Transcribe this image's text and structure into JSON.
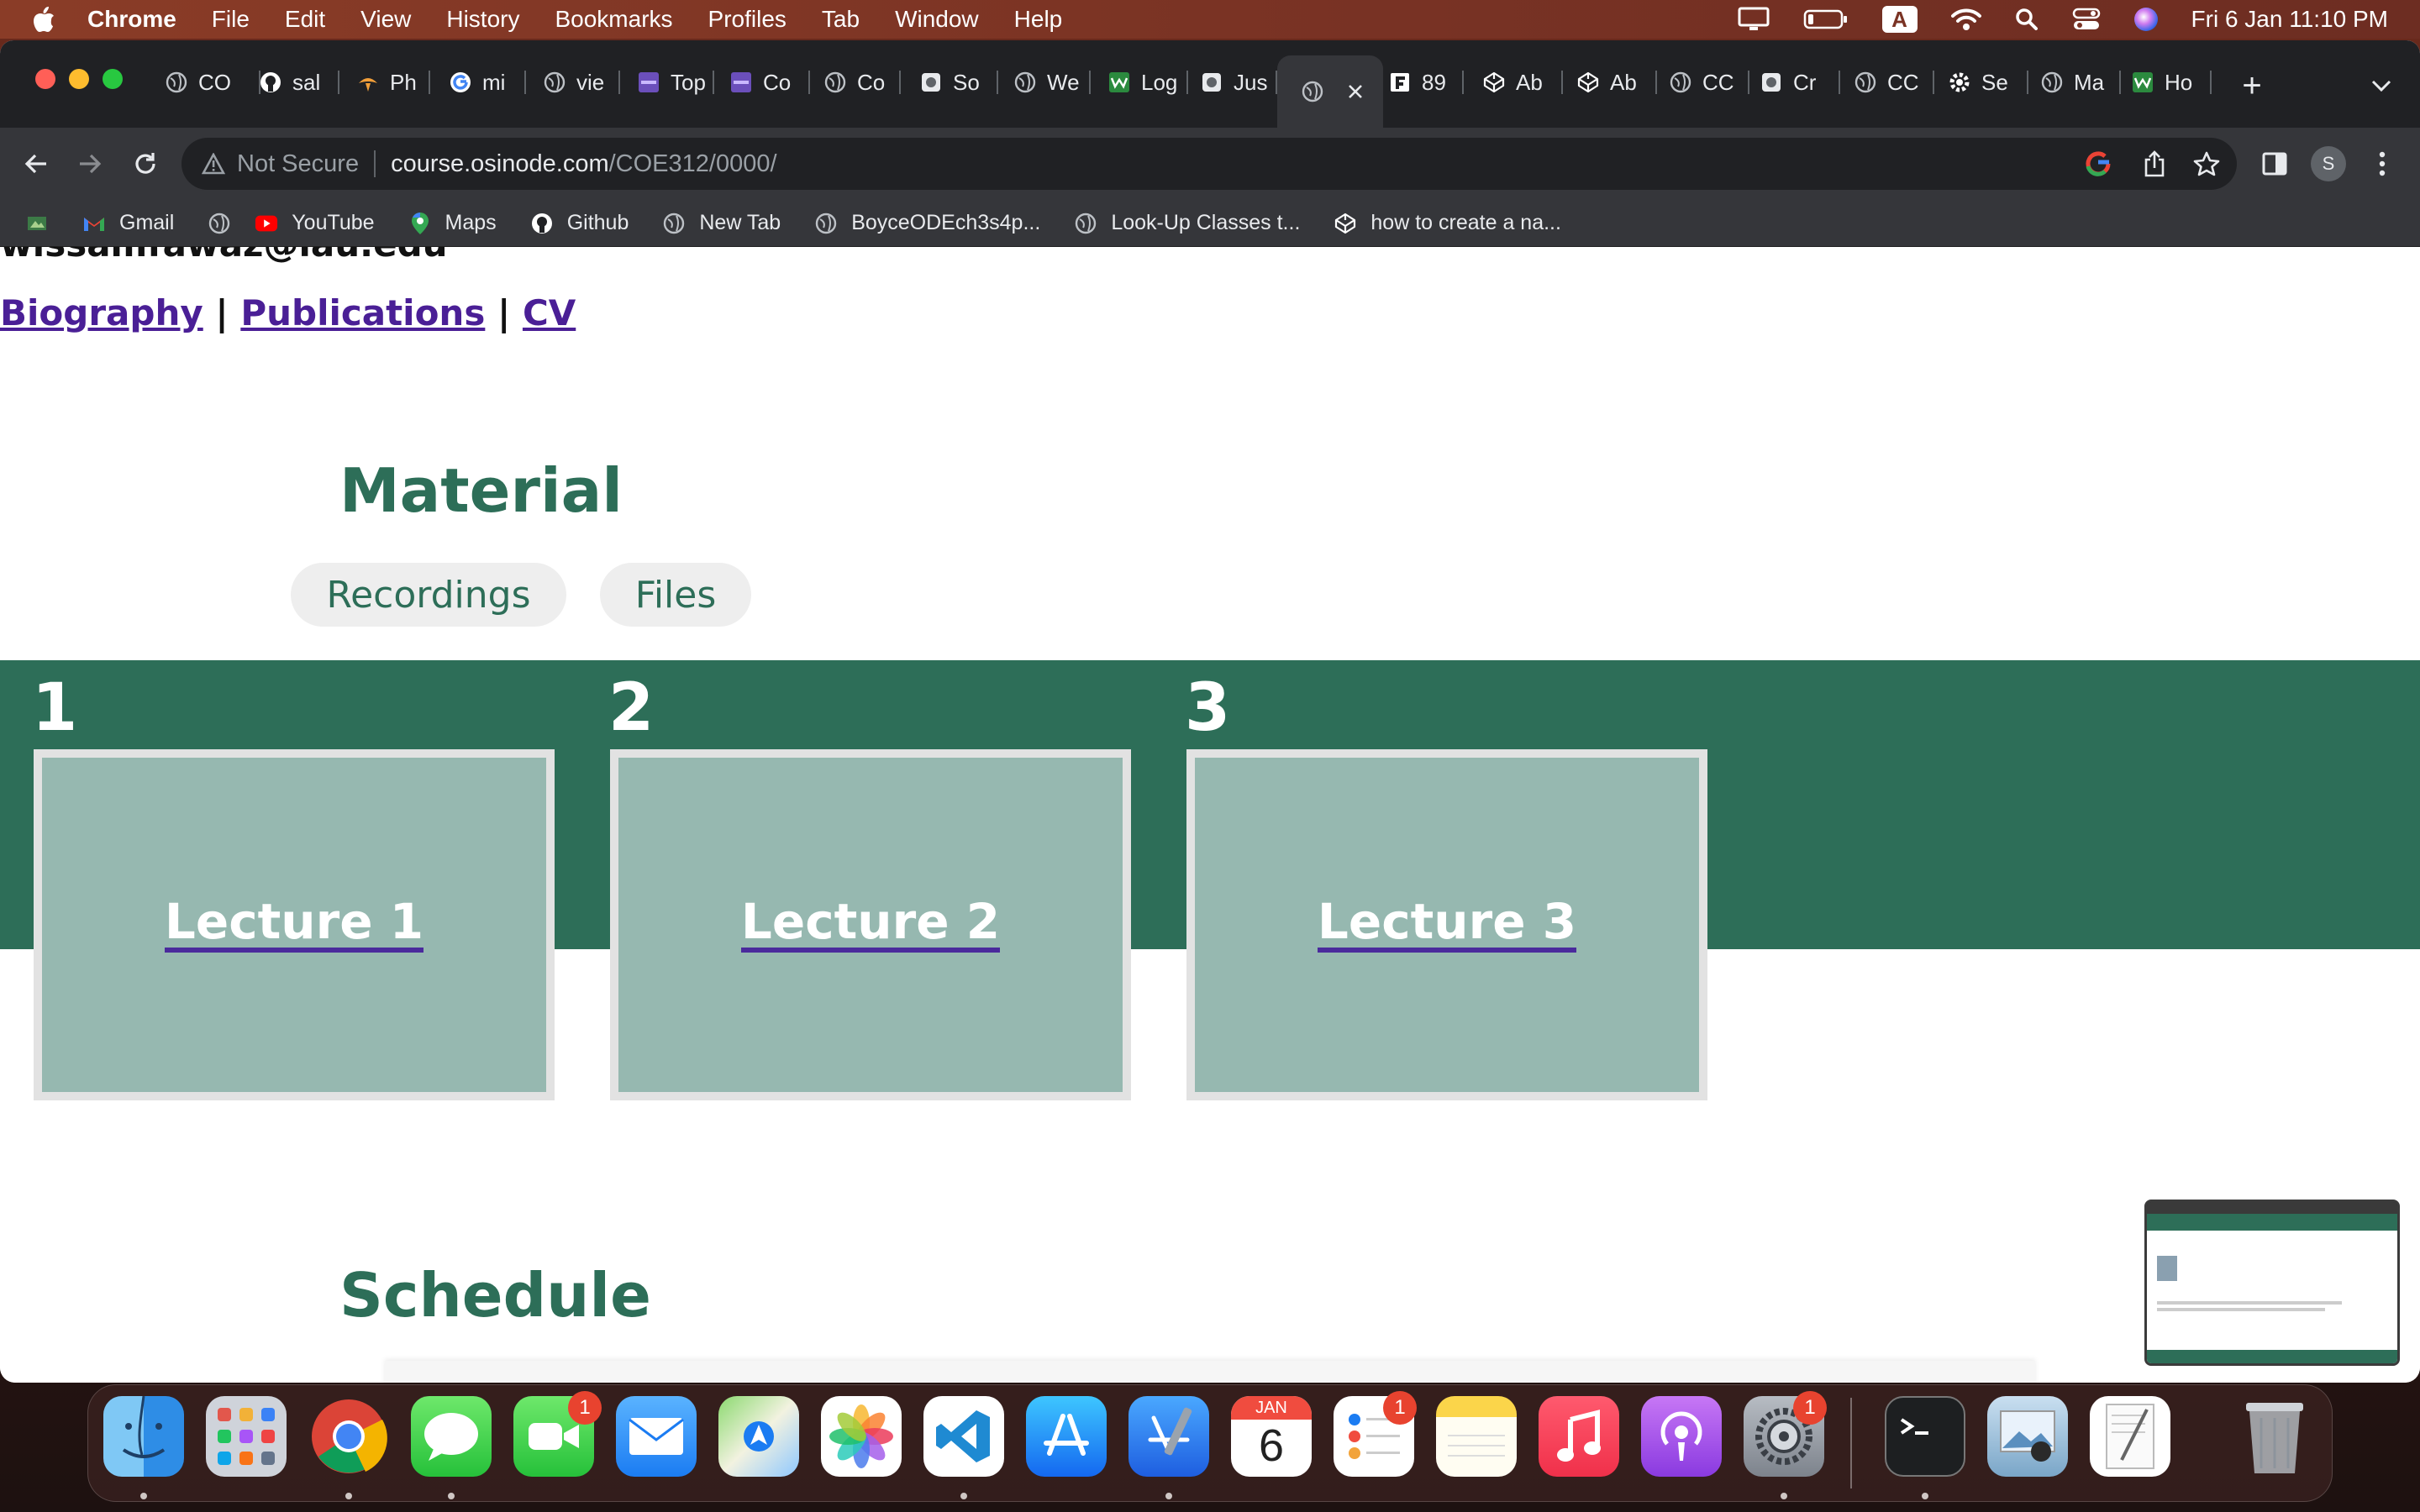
{
  "menubar": {
    "app": "Chrome",
    "items": [
      "File",
      "Edit",
      "View",
      "History",
      "Bookmarks",
      "Profiles",
      "Tab",
      "Window",
      "Help"
    ],
    "clock": "Fri 6 Jan  11:10 PM",
    "input_source": "A"
  },
  "tabs": [
    {
      "label": "CO",
      "icon": "globe-icon"
    },
    {
      "label": "sal",
      "icon": "github-icon"
    },
    {
      "label": "Ph",
      "icon": "phoenix-icon"
    },
    {
      "label": "mi",
      "icon": "google-icon"
    },
    {
      "label": "vie",
      "icon": "globe-icon"
    },
    {
      "label": "Top",
      "icon": "colorlib-icon"
    },
    {
      "label": "Co",
      "icon": "colorlib-icon"
    },
    {
      "label": "Co",
      "icon": "globe-icon"
    },
    {
      "label": "So",
      "icon": "site-icon"
    },
    {
      "label": "We",
      "icon": "globe-icon"
    },
    {
      "label": "Log",
      "icon": "w3-icon"
    },
    {
      "label": "Jus",
      "icon": "site-icon"
    },
    {
      "label": "",
      "icon": "globe-icon",
      "active": true
    },
    {
      "label": "89",
      "icon": "f-icon"
    },
    {
      "label": "Ab",
      "icon": "codepen-icon"
    },
    {
      "label": "Ab",
      "icon": "codepen-icon"
    },
    {
      "label": "CC",
      "icon": "globe-icon"
    },
    {
      "label": "Cr",
      "icon": "site-icon"
    },
    {
      "label": "CC",
      "icon": "globe-icon"
    },
    {
      "label": "Se",
      "icon": "gear-icon"
    },
    {
      "label": "Ma",
      "icon": "globe-icon"
    },
    {
      "label": "Ho",
      "icon": "w3-icon"
    }
  ],
  "address": {
    "security": "Not Secure",
    "host": "course.osinode.com",
    "path": "/COE312/0000/"
  },
  "profile_initial": "S",
  "bookmarks": [
    {
      "label": "Gmail",
      "icon": "gmail-icon"
    },
    {
      "label": "",
      "icon": "globe-icon"
    },
    {
      "label": "YouTube",
      "icon": "youtube-icon"
    },
    {
      "label": "Maps",
      "icon": "maps-icon"
    },
    {
      "label": "Github",
      "icon": "github-icon"
    },
    {
      "label": "New Tab",
      "icon": "globe-icon"
    },
    {
      "label": "BoyceODEch3s4p...",
      "icon": "globe-icon"
    },
    {
      "label": "Look-Up Classes t...",
      "icon": "globe-icon"
    },
    {
      "label": "how to create a na...",
      "icon": "codepen-icon"
    }
  ],
  "page": {
    "email": "wissamfawaz@lau.edu",
    "links": [
      "Biography",
      "Publications",
      "CV"
    ],
    "link_separator": "|",
    "material_heading": "Material",
    "material_tabs": [
      "Recordings",
      "Files"
    ],
    "lectures": [
      {
        "number": "1",
        "title": "Lecture 1"
      },
      {
        "number": "2",
        "title": "Lecture 2"
      },
      {
        "number": "3",
        "title": "Lecture 3"
      }
    ],
    "schedule_heading": "Schedule"
  },
  "dock": [
    {
      "name": "finder"
    },
    {
      "name": "launchpad"
    },
    {
      "name": "chrome",
      "running": true
    },
    {
      "name": "messages",
      "running": true
    },
    {
      "name": "facetime",
      "badge": "1"
    },
    {
      "name": "mail"
    },
    {
      "name": "maps"
    },
    {
      "name": "photos"
    },
    {
      "name": "vscode",
      "running": true
    },
    {
      "name": "app-store"
    },
    {
      "name": "xcode",
      "running": true
    },
    {
      "name": "calendar",
      "month": "JAN",
      "day": "6"
    },
    {
      "name": "reminders",
      "badge": "1"
    },
    {
      "name": "notes"
    },
    {
      "name": "music"
    },
    {
      "name": "podcasts"
    },
    {
      "name": "system-settings",
      "badge": "1",
      "running": true
    },
    {
      "name": "terminal",
      "running": true
    },
    {
      "name": "preview"
    },
    {
      "name": "textedit"
    },
    {
      "name": "trash"
    }
  ],
  "colors": {
    "brand_green": "#2d6e58",
    "card_fill": "#96b8b0",
    "link_purple": "#4a1f96"
  }
}
